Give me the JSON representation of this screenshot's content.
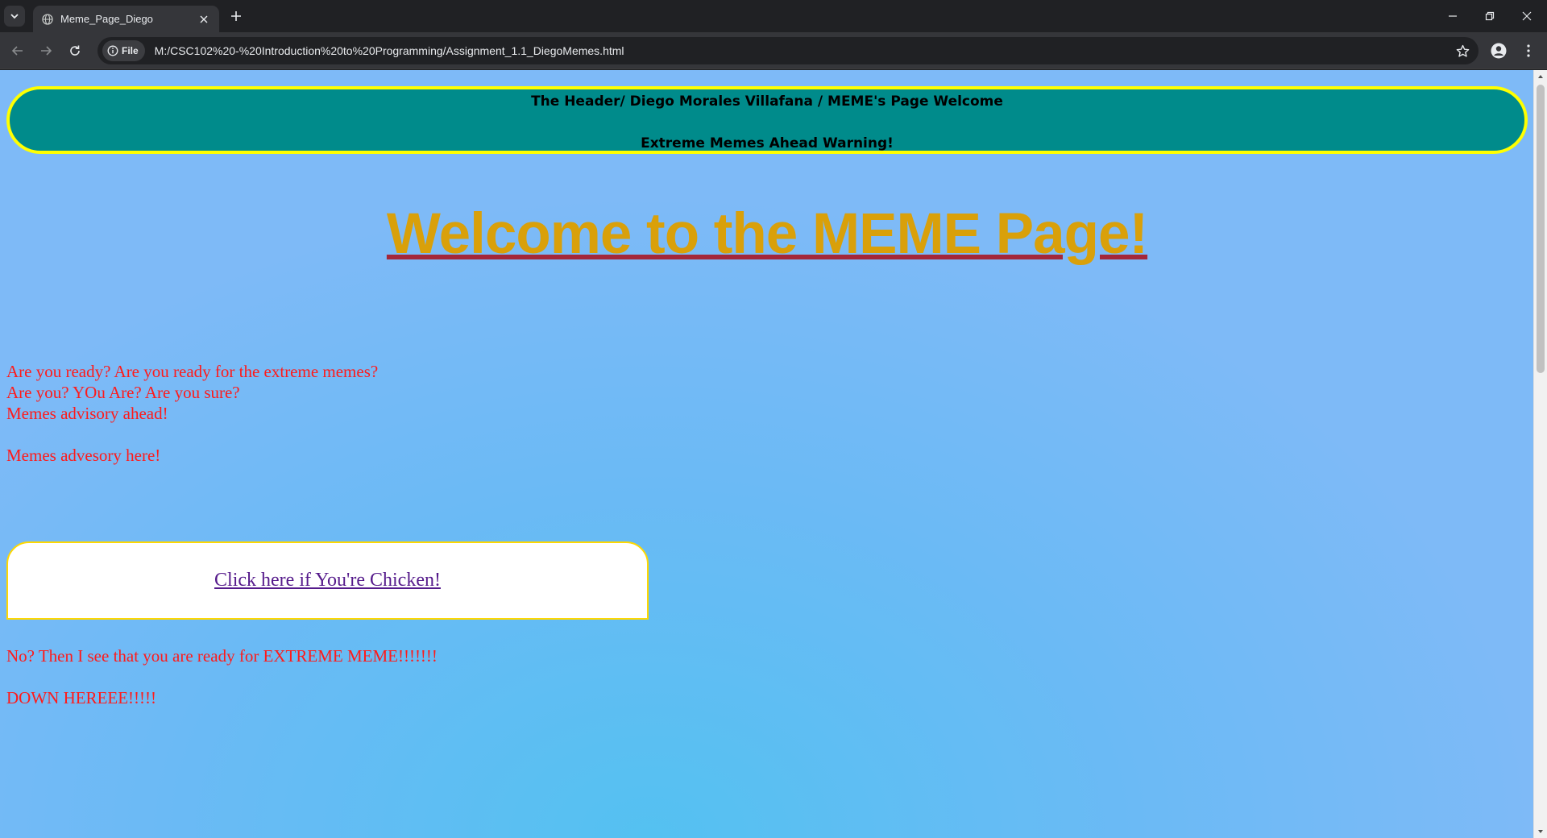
{
  "browser": {
    "tab_title": "Meme_Page_Diego",
    "chip_label": "File",
    "url": "M:/CSC102%20-%20Introduction%20to%20Programming/Assignment_1.1_DiegoMemes.html"
  },
  "page": {
    "header_line1": "The Header/ Diego Morales Villafana / MEME's Page Welcome",
    "header_line2": "Extreme Memes Ahead Warning!",
    "main_title": "Welcome to the MEME Page!",
    "intro_lines": [
      "Are you ready? Are you ready for the extreme memes?",
      "Are you? YOu Are? Are you sure?",
      "Memes advisory ahead!",
      "Memes advesory here!"
    ],
    "chicken_link": "Click here if You're Chicken!",
    "outro_lines": [
      "No? Then I see that you are ready for EXTREME MEME!!!!!!!",
      "DOWN HEREEE!!!!!"
    ]
  },
  "colors": {
    "header_bg": "#008b8b",
    "header_border": "#ffff00",
    "title": "#d9a00a",
    "title_underline": "#a4273a",
    "body_text": "#ff1a1a",
    "link": "#551a8b"
  }
}
